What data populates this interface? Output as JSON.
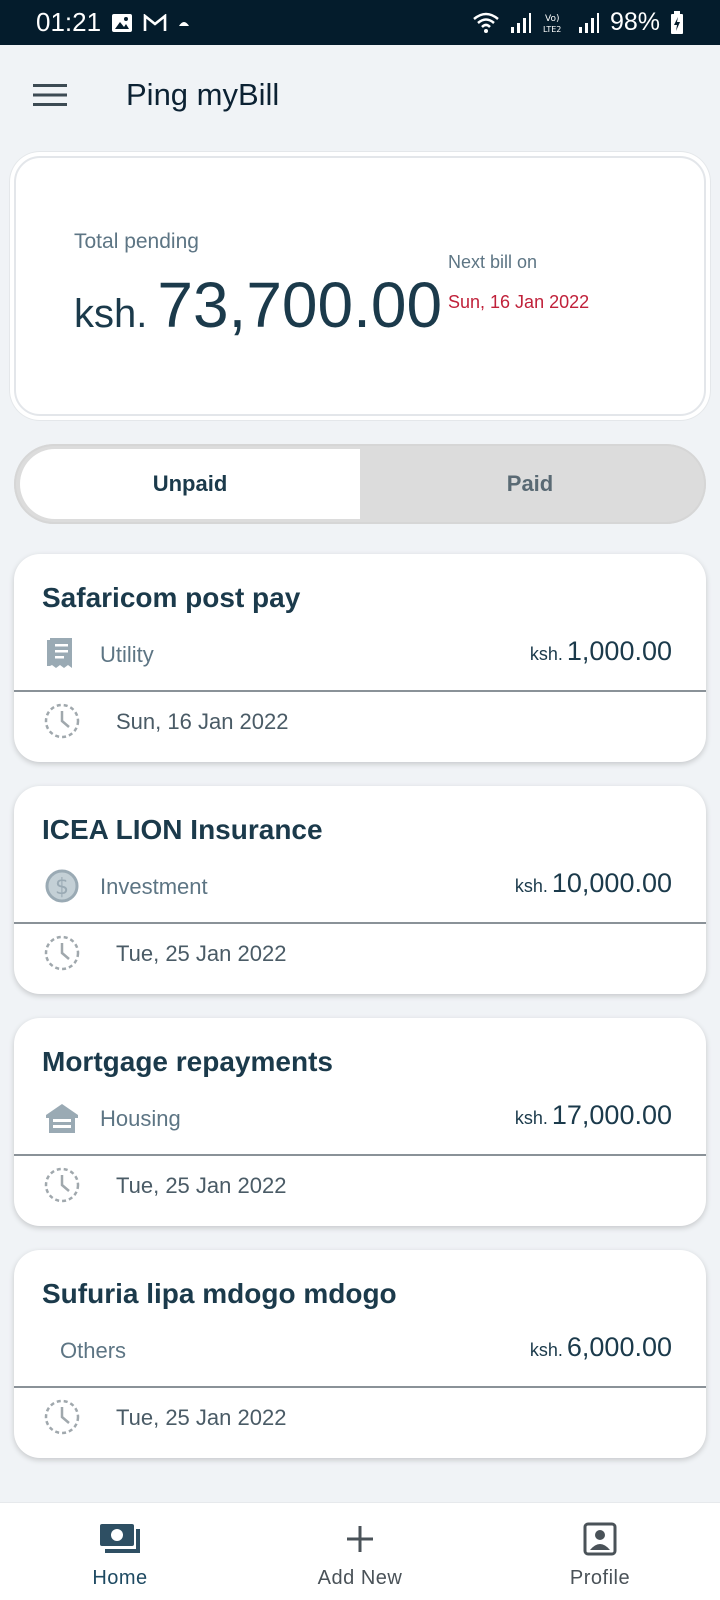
{
  "status_bar": {
    "time": "01:21",
    "battery": "98%"
  },
  "app": {
    "title": "Ping myBill"
  },
  "summary": {
    "total_label": "Total pending",
    "currency": "ksh.",
    "total_amount": "73,700.00",
    "next_label": "Next bill on",
    "next_date": "Sun, 16 Jan 2022",
    "next_date_color": "#c0213a"
  },
  "toggle": {
    "unpaid_label": "Unpaid",
    "paid_label": "Paid",
    "active": "Unpaid"
  },
  "bills": [
    {
      "name": "Safaricom post pay",
      "category": "Utility",
      "icon": "receipt-icon",
      "currency": "ksh.",
      "amount": "1,000.00",
      "date": "Sun, 16 Jan 2022"
    },
    {
      "name": "ICEA LION Insurance",
      "category": "Investment",
      "icon": "dollar-icon",
      "currency": "ksh.",
      "amount": "10,000.00",
      "date": "Tue, 25 Jan 2022"
    },
    {
      "name": "Mortgage repayments",
      "category": "Housing",
      "icon": "house-icon",
      "currency": "ksh.",
      "amount": "17,000.00",
      "date": "Tue, 25 Jan 2022"
    },
    {
      "name": "Sufuria lipa mdogo mdogo",
      "category": "Others",
      "icon": "",
      "currency": "ksh.",
      "amount": "6,000.00",
      "date": "Tue, 25 Jan 2022"
    }
  ],
  "nav": {
    "home": "Home",
    "add_new": "Add New",
    "profile": "Profile",
    "active": "Home"
  },
  "colors": {
    "primary_text": "#1b3a4b",
    "status_bar_bg": "#041c2c",
    "accent_red": "#c0213a"
  }
}
